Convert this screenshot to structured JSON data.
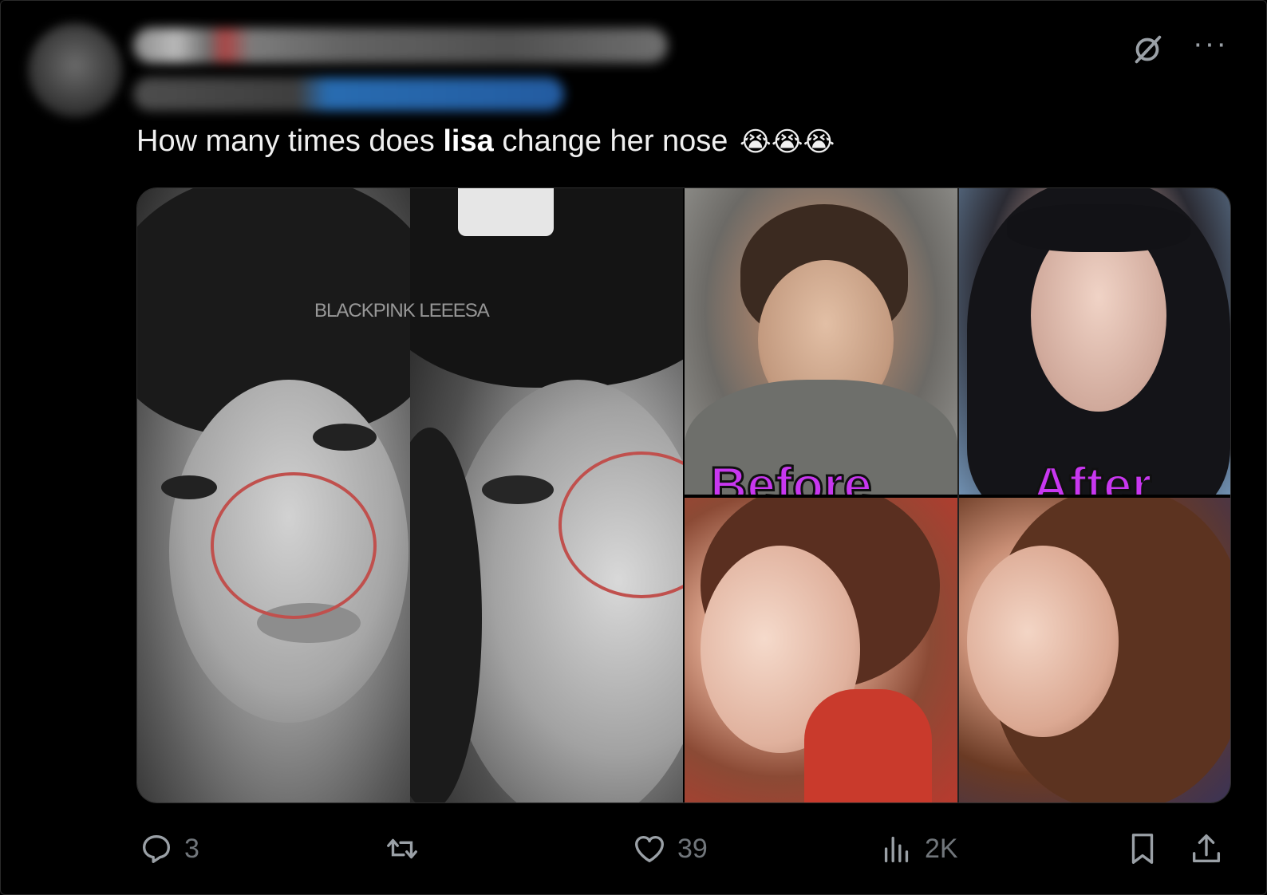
{
  "tweet": {
    "text_parts": {
      "before": "How many times does ",
      "bold": "lisa",
      "after": " change her nose ",
      "emoji": "😭😭😭"
    },
    "icons": {
      "grok": "grok-slash-icon",
      "more": "more-dots-icon"
    },
    "more_glyph": "···"
  },
  "media": {
    "watermark": "BLACKPINK LEEESA",
    "before_label": "Before",
    "after_label": "After",
    "highlight_color": "#c0504d",
    "label_color": "#c837f0"
  },
  "actions": {
    "reply_count": "3",
    "repost_count": "",
    "like_count": "39",
    "views_count": "2K"
  },
  "colors": {
    "background": "#000000",
    "muted": "#71767b",
    "text": "#e7e9ea"
  }
}
